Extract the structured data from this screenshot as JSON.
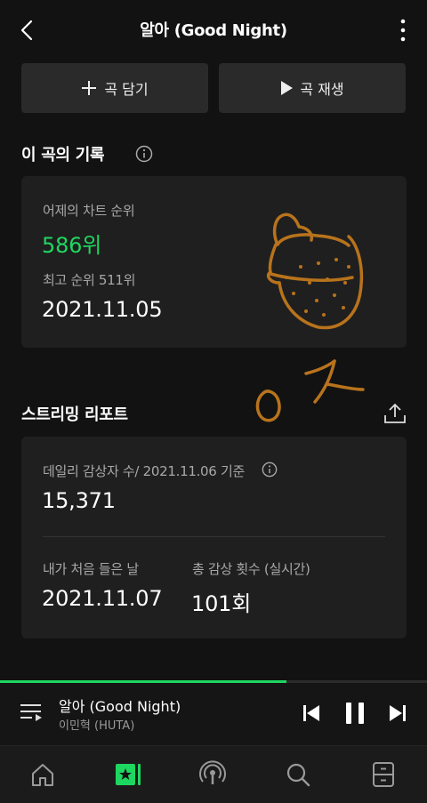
{
  "header": {
    "title": "알아 (Good Night)"
  },
  "actions": {
    "add_label": "곡 담기",
    "play_label": "곡 재생"
  },
  "record": {
    "section_title": "이 곡의 기록",
    "chart_label": "어제의 차트 순위",
    "chart_rank": "586위",
    "best_label": "최고 순위 511위",
    "best_date": "2021.11.05"
  },
  "streaming": {
    "section_title": "스트리밍 리포트",
    "daily_label": "데일리 감상자 수/ 2021.11.06 기준",
    "daily_value": "15,371",
    "first_label": "내가 처음 들은 날",
    "first_value": "2021.11.07",
    "total_label": "총 감상 횟수 (실시간)",
    "total_value": "101회"
  },
  "player": {
    "song": "알아 (Good Night)",
    "artist": "이민혁 (HUTA)",
    "progress": 0.67
  },
  "colors": {
    "accent": "#1ed760",
    "background": "#121212",
    "card": "#1f1f1f",
    "doodle": "#b8731c"
  }
}
